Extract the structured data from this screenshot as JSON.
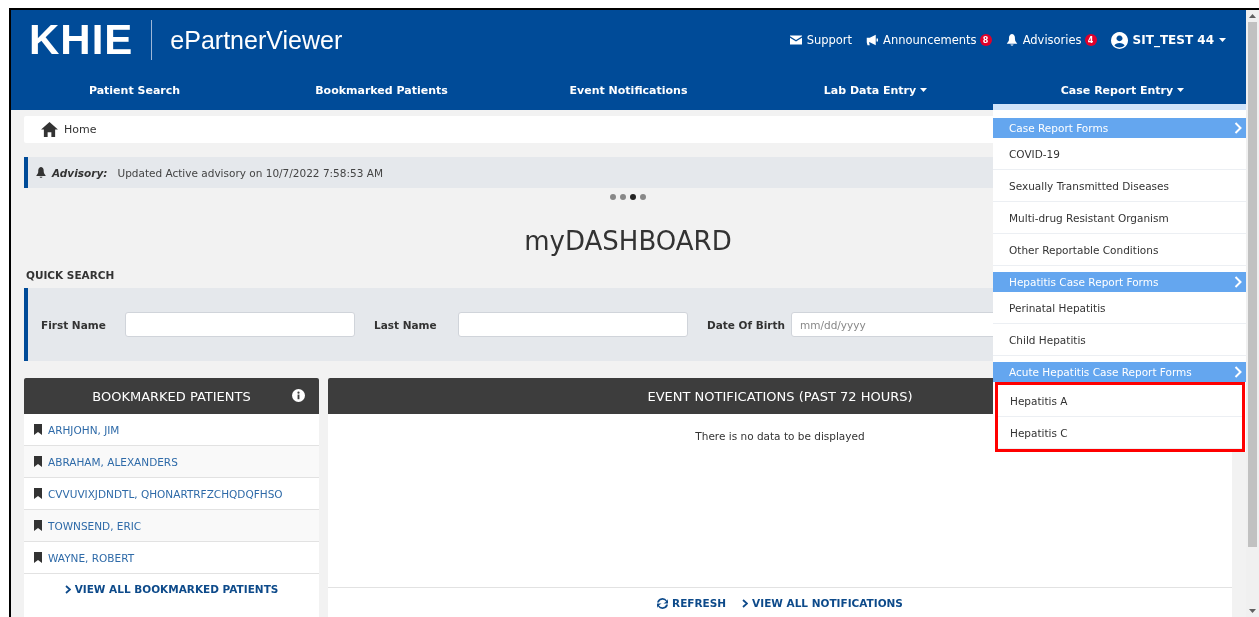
{
  "header": {
    "logo": "KHIE",
    "app_name": "ePartnerViewer",
    "utility_links": [
      {
        "kind": "support",
        "label": "Support"
      },
      {
        "kind": "announcements",
        "label": "Announcements",
        "badge": "8"
      },
      {
        "kind": "advisories",
        "label": "Advisories",
        "badge": "4"
      },
      {
        "kind": "user",
        "label": "SIT_TEST 44",
        "dropdown": true
      }
    ]
  },
  "nav": [
    {
      "label": "Patient Search",
      "dropdown": false
    },
    {
      "label": "Bookmarked Patients",
      "dropdown": false
    },
    {
      "label": "Event Notifications",
      "dropdown": false
    },
    {
      "label": "Lab Data Entry",
      "dropdown": true
    },
    {
      "label": "Case Report Entry",
      "dropdown": true
    }
  ],
  "breadcrumb": "Home",
  "advisory": {
    "label": "Advisory:",
    "text": "Updated Active advisory on 10/7/2022 7:58:53 AM"
  },
  "carousel_dots": [
    {
      "selected": false
    },
    {
      "selected": false
    },
    {
      "selected": true
    },
    {
      "selected": false
    }
  ],
  "title": "myDASHBOARD",
  "quick_search": {
    "heading": "QUICK SEARCH",
    "fields": [
      {
        "label": "First Name"
      },
      {
        "label": "Last Name"
      },
      {
        "label": "Date Of Birth",
        "placeholder": "mm/dd/yyyy"
      }
    ]
  },
  "bookmarked_patients": {
    "title": "BOOKMARKED PATIENTS",
    "patients": [
      "ARHJOHN, JIM",
      "ABRAHAM, ALEXANDERS",
      "CVVUVIXJDNDTL, QHONARTRFZCHQDQFHSO",
      "TOWNSEND, ERIC",
      "WAYNE, ROBERT"
    ],
    "footer_link": "VIEW ALL BOOKMARKED PATIENTS"
  },
  "event_notifications": {
    "title": "EVENT NOTIFICATIONS (PAST 72 HOURS)",
    "empty_text": "There is no data to be displayed",
    "refresh": "REFRESH",
    "footer_link": "VIEW ALL NOTIFICATIONS"
  },
  "case_report_menu": [
    {
      "heading": "Case Report Forms",
      "highlighted": false,
      "items": [
        "COVID-19",
        "Sexually Transmitted Diseases",
        "Multi-drug Resistant Organism",
        "Other Reportable Conditions"
      ]
    },
    {
      "heading": "Hepatitis Case Report Forms",
      "highlighted": false,
      "items": [
        "Perinatal Hepatitis",
        "Child Hepatitis"
      ]
    },
    {
      "heading": "Acute Hepatitis Case Report Forms",
      "highlighted": true,
      "items": [
        "Hepatitis A",
        "Hepatitis C"
      ]
    }
  ]
}
